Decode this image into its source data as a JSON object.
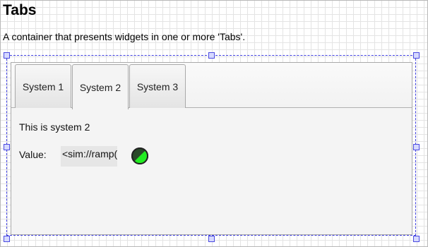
{
  "page": {
    "title": "Tabs",
    "description": "A container that presents widgets in one or more 'Tabs'."
  },
  "tabs_widget": {
    "tabs": [
      {
        "label": "System 1",
        "active": false
      },
      {
        "label": "System 2",
        "active": true
      },
      {
        "label": "System 3",
        "active": false
      }
    ],
    "content_text": "This is system 2",
    "value_label": "Value:",
    "value_text": "<sim://ramp(",
    "led": {
      "colors": {
        "on": "#22ee22",
        "off": "#2a4a2a",
        "border": "#222222"
      }
    }
  },
  "selection": {
    "color": "#4040e0",
    "handle_fill": "#d6d9ff"
  }
}
